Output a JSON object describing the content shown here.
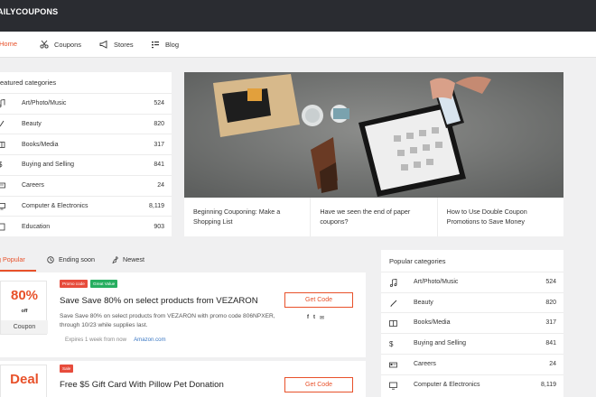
{
  "brand": {
    "logo": "AILYCOUPONS",
    "accent": "#e8512a"
  },
  "nav": [
    {
      "label": "Home",
      "icon": "home",
      "active": true
    },
    {
      "label": "Coupons",
      "icon": "scissors-icon"
    },
    {
      "label": "Stores",
      "icon": "megaphone-icon"
    },
    {
      "label": "Blog",
      "icon": "list-icon"
    }
  ],
  "featured": {
    "title": "eatured categories",
    "items": [
      {
        "label": "Art/Photo/Music",
        "count": "524",
        "icon": "music-icon"
      },
      {
        "label": "Beauty",
        "count": "820",
        "icon": "brush-icon"
      },
      {
        "label": "Books/Media",
        "count": "317",
        "icon": "book-icon"
      },
      {
        "label": "Buying and Selling",
        "count": "841",
        "icon": "dollar-icon"
      },
      {
        "label": "Careers",
        "count": "24",
        "icon": "id-card-icon"
      },
      {
        "label": "Computer & Electronics",
        "count": "8,119",
        "icon": "monitor-icon"
      },
      {
        "label": "Education",
        "count": "903",
        "icon": "building-icon"
      }
    ]
  },
  "hero": {
    "posts": [
      {
        "title": "Beginning Couponing: Make a Shopping List"
      },
      {
        "title": "Have we seen the end of paper coupons?"
      },
      {
        "title": "How to Use Double Coupon Promotions to Save Money"
      }
    ]
  },
  "tabs": [
    {
      "label": "g Popular",
      "icon": "",
      "active": true
    },
    {
      "label": "Ending soon",
      "icon": "clock-icon"
    },
    {
      "label": "Newest",
      "icon": "pin-icon"
    }
  ],
  "coupons": [
    {
      "big": "80%",
      "off": "off",
      "type": "Coupon",
      "badges": [
        {
          "label": "Promo code",
          "color": "#e74c3c"
        },
        {
          "label": "Great Value",
          "color": "#27ae60"
        }
      ],
      "title": "Save Save 80% on select products from VEZARON",
      "desc": "Save Save 80% on select products from VEZARON with promo code 806NPXER, through 10/23 while supplies last.",
      "expires": "Expires 1 week from now",
      "store": "Amazon.com",
      "button": "Get Code",
      "share": [
        "f",
        "t",
        "✉"
      ]
    },
    {
      "big": "Deal",
      "badges": [
        {
          "label": "Sale",
          "color": "#e74c3c"
        }
      ],
      "title": "Free $5 Gift Card With Pillow Pet Donation",
      "button": "Get Code"
    }
  ],
  "popular": {
    "title": "Popular categories",
    "items": [
      {
        "label": "Art/Photo/Music",
        "count": "524",
        "icon": "music-icon"
      },
      {
        "label": "Beauty",
        "count": "820",
        "icon": "brush-icon"
      },
      {
        "label": "Books/Media",
        "count": "317",
        "icon": "book-icon"
      },
      {
        "label": "Buying and Selling",
        "count": "841",
        "icon": "dollar-icon"
      },
      {
        "label": "Careers",
        "count": "24",
        "icon": "id-card-icon"
      },
      {
        "label": "Computer & Electronics",
        "count": "8,119",
        "icon": "monitor-icon"
      }
    ]
  }
}
